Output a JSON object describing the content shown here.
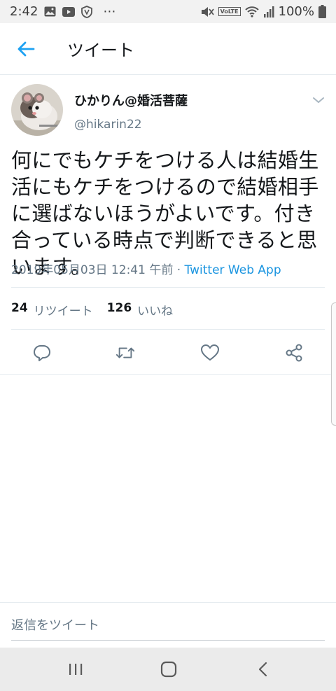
{
  "status_bar": {
    "time": "2:42",
    "more": "⋯",
    "network": "VoLTE",
    "battery": "100%",
    "icons": [
      "gallery-icon",
      "youtube-icon",
      "shield-icon",
      "mute-icon",
      "wifi-icon",
      "signal-icon",
      "battery-icon"
    ]
  },
  "header": {
    "title": "ツイート",
    "back_icon": "arrow-left-icon"
  },
  "tweet": {
    "display_name": "ひかりん@婚活菩薩",
    "handle": "@hikarin22",
    "text": "何にでもケチをつける人は結婚生活にもケチをつけるので結婚相手に選ばないほうがよいです。付き合っている時点で判断できると思います。",
    "timestamp": "2019年05月03日 12:41 午前 · ",
    "via": "Twitter Web App",
    "retweet_count": "24",
    "retweet_label": "リツイート",
    "like_count": "126",
    "like_label": "いいね",
    "actions": [
      "reply-icon",
      "retweet-icon",
      "like-icon",
      "share-icon"
    ]
  },
  "reply": {
    "placeholder": "返信をツイート"
  },
  "colors": {
    "accent": "#1da1f2",
    "link": "#1b95e0",
    "muted": "#657786",
    "text": "#14171a"
  }
}
